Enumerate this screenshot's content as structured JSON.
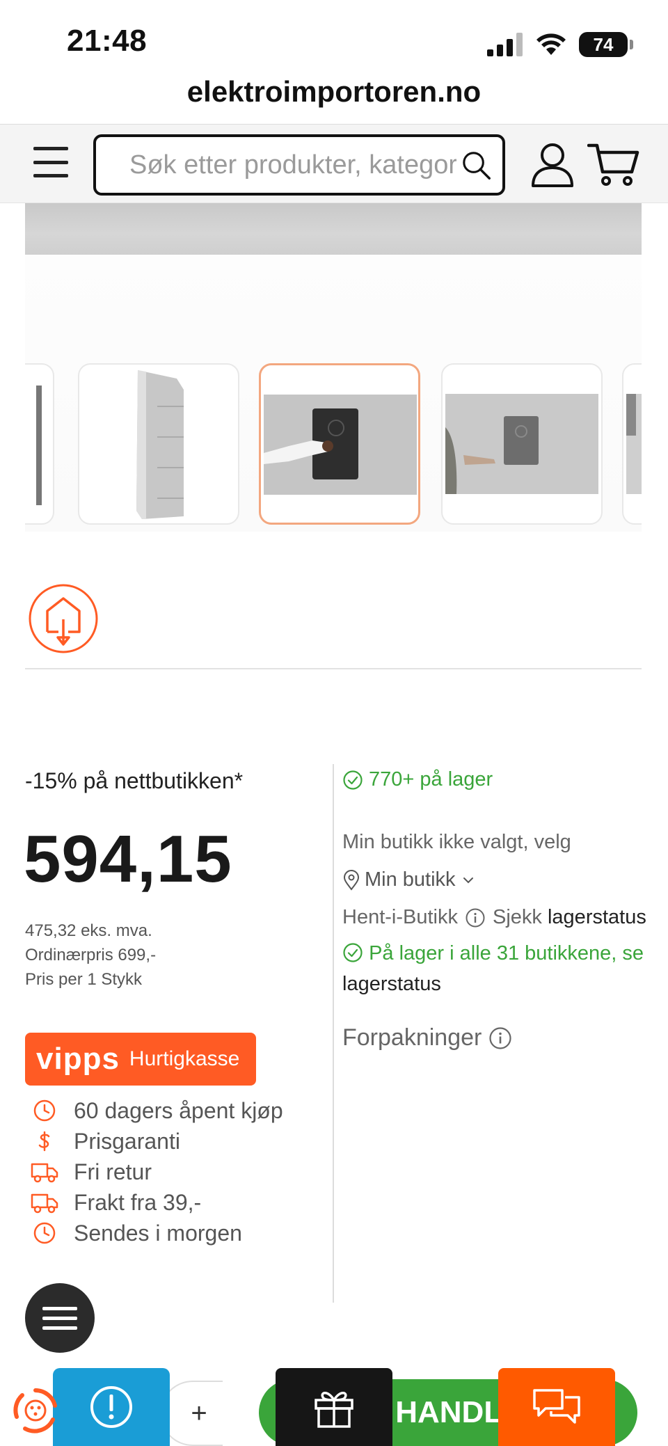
{
  "status_bar": {
    "time": "21:48",
    "battery": "74"
  },
  "browser": {
    "url": "elektroimportoren.no"
  },
  "header": {
    "search_placeholder": "Søk etter produkter, kategorier"
  },
  "icons": {
    "menu": "hamburger-menu-icon",
    "search": "search-icon",
    "user": "user-icon",
    "cart": "cart-icon",
    "certification": "house-arrow-logo",
    "stock_check": "check-circle-icon",
    "location": "map-pin-icon",
    "info": "info-icon",
    "gift": "gift-icon",
    "chat": "chat-bubbles-icon",
    "feedback": "exclamation-circle-icon",
    "recycle": "recycle-icon"
  },
  "colors": {
    "accent_orange": "#ff5b24",
    "stock_green": "#3aa53a",
    "feedback_blue": "#1a9dd6",
    "dark": "#161616"
  },
  "product": {
    "discount": "-15% på nettbutikken*",
    "price": "594,15",
    "ex_vat": "475,32 eks. mva.",
    "regular_price": "Ordinærpris 699,-",
    "unit_price": "Pris per 1 Stykk"
  },
  "vipps": {
    "logo": "vipps",
    "label": "Hurtigkasse"
  },
  "benefits": [
    {
      "icon": "clock-icon",
      "label": "60 dagers åpent kjøp"
    },
    {
      "icon": "dollar-icon",
      "label": "Prisgaranti"
    },
    {
      "icon": "truck-icon",
      "label": "Fri retur"
    },
    {
      "icon": "truck-icon",
      "label": "Frakt fra 39,-"
    },
    {
      "icon": "clock-icon",
      "label": "Sendes i morgen"
    }
  ],
  "stock": {
    "online": "770+ på lager",
    "store_note": "Min butikk ikke valgt, velg",
    "my_store": "Min butikk",
    "pickup_label": "Hent-i-Butikk",
    "pickup_check": "Sjekk",
    "pickup_link": "lagerstatus",
    "all_stores": "På lager i alle 31 butikkene, se",
    "all_stores_link": "lagerstatus",
    "packaging": "Forpakninger"
  },
  "bottom": {
    "qty_plus": "+",
    "add_to_cart": "LEGG I HANDLEVOGN"
  }
}
